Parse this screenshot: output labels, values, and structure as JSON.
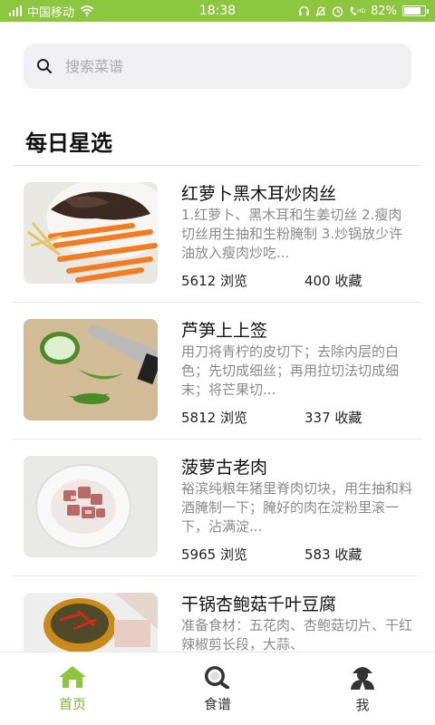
{
  "status_bar": {
    "carrier": "中国移动",
    "time": "18:38",
    "battery": "82%",
    "battery_level": 0.82,
    "icons": [
      "signal-icon",
      "wifi-icon",
      "headset-icon",
      "bell-icon",
      "alarm-icon",
      "hd-call-icon",
      "battery-icon"
    ]
  },
  "search": {
    "placeholder": "搜索菜谱",
    "value": ""
  },
  "section": {
    "title": "每日星选"
  },
  "recipes": [
    {
      "title": "红萝卜黑木耳炒肉丝",
      "desc": "1.红萝卜、黑木耳和生姜切丝 2.瘦肉切丝用生抽和生粉腌制 3.炒锅放少许油放入瘦肉炒吃...",
      "views": "5612 浏览",
      "favorites": "400 收藏"
    },
    {
      "title": "芦笋上上签",
      "desc": "用刀将青柠的皮切下；去除内层的白色；先切成细丝；再用拉切法切成细末；将芒果切...",
      "views": "5812 浏览",
      "favorites": "337 收藏"
    },
    {
      "title": "菠萝古老肉",
      "desc": "裕滨纯粮年猪里脊肉切块，用生抽和料酒腌制一下；腌好的肉在淀粉里滚一下，沾满淀...",
      "views": "5965 浏览",
      "favorites": "583 收藏"
    },
    {
      "title": "干锅杏鲍菇千叶豆腐",
      "desc": "准备食材：五花肉、杏鲍菇切片、干红辣椒剪长段，大蒜、",
      "views": "",
      "favorites": ""
    }
  ],
  "tabs": [
    {
      "label": "首页",
      "icon": "home-icon",
      "active": true
    },
    {
      "label": "食谱",
      "icon": "pan-icon",
      "active": false
    },
    {
      "label": "我",
      "icon": "user-icon",
      "active": false
    }
  ],
  "colors": {
    "accent": "#8cc63f",
    "active_tab": "#7cb82f",
    "desc_text": "#8a8a8a",
    "search_bg": "#f0f0f2"
  }
}
